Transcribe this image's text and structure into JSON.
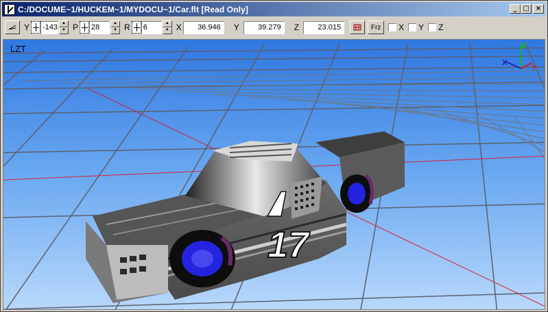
{
  "window": {
    "title": "C:/DOCUME~1/HUCKEM~1/MYDOCU~1/Car.flt [Read Only]",
    "controls": [
      "minimize",
      "maximize",
      "close"
    ]
  },
  "toolbar": {
    "yaw_label": "Y",
    "yaw_value": "-143",
    "pitch_label": "P",
    "pitch_value": "28",
    "roll_label": "R",
    "roll_value": "6",
    "x_label": "X",
    "x_value": "36.946",
    "y_label": "Y",
    "y_value": "39.279",
    "z_label": "Z",
    "z_value": "23.015",
    "freeze_label": "Frz",
    "check_x": "X",
    "check_y": "Y",
    "check_z": "Z"
  },
  "viewport": {
    "label": "LZT",
    "axis_x": "X",
    "axis_y": "Y",
    "axis_z": "Z",
    "sky_color": "#4a90e8",
    "grid_color": "#5a6070",
    "axis_line_color": "#d8203a",
    "car_number": "17"
  }
}
